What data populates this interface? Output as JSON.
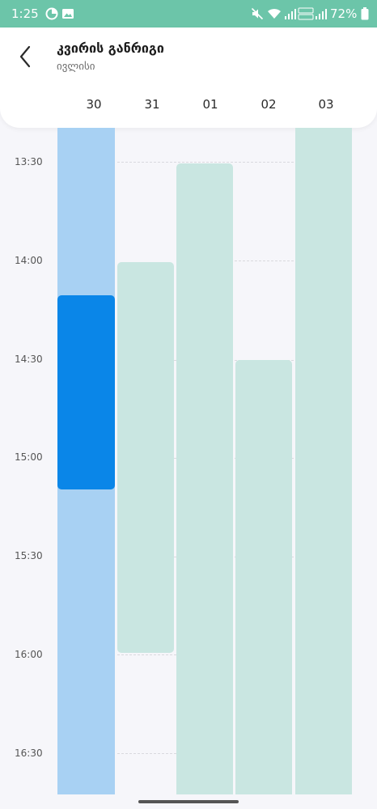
{
  "status_bar": {
    "time": "1:25",
    "battery": "72%",
    "icons": [
      "data-saver-icon",
      "gallery-icon",
      "mute-icon",
      "wifi-icon",
      "signal-icon",
      "volte-lte-icon",
      "signal-icon",
      "battery-icon"
    ]
  },
  "header": {
    "title": "კვირის განრიგი",
    "subtitle": "ივლისი",
    "days": [
      "30",
      "31",
      "01",
      "02",
      "03"
    ]
  },
  "times": [
    "13:30",
    "14:00",
    "14:30",
    "15:00",
    "15:30",
    "16:00",
    "16:30"
  ],
  "colors": {
    "status_bar": "#6cc5a9",
    "selected_column": "#a8d1f3",
    "selected_block": "#0a86e8",
    "available_block": "#c9e6e1"
  }
}
